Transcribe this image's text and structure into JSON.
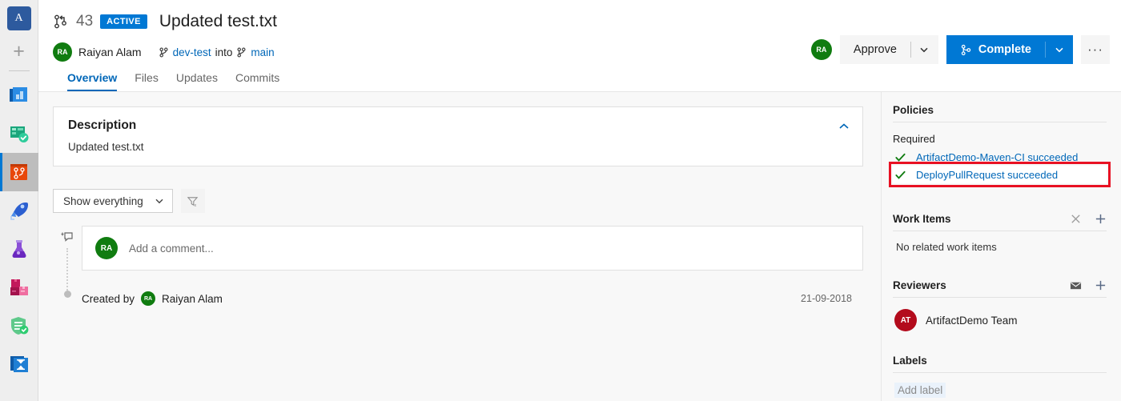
{
  "rail": {
    "org_initial": "A",
    "add_label": "+",
    "items": [
      {
        "name": "overview",
        "icon": "overview-icon"
      },
      {
        "name": "boards",
        "icon": "boards-icon"
      },
      {
        "name": "repos",
        "icon": "repos-icon",
        "selected": true
      },
      {
        "name": "pipelines",
        "icon": "pipelines-icon"
      },
      {
        "name": "test-plans",
        "icon": "test-plans-icon"
      },
      {
        "name": "artifacts",
        "icon": "artifacts-icon"
      },
      {
        "name": "security",
        "icon": "shield-icon"
      },
      {
        "name": "analytics",
        "icon": "hourglass-icon"
      }
    ]
  },
  "header": {
    "pr_number": "43",
    "status_badge": "ACTIVE",
    "title": "Updated test.txt",
    "author": "Raiyan Alam",
    "author_initials": "RA",
    "source_branch": "dev-test",
    "into_word": "into",
    "target_branch": "main",
    "tabs": [
      {
        "label": "Overview",
        "active": true
      },
      {
        "label": "Files",
        "active": false
      },
      {
        "label": "Updates",
        "active": false
      },
      {
        "label": "Commits",
        "active": false
      }
    ]
  },
  "actions": {
    "user_initials": "RA",
    "approve_label": "Approve",
    "complete_label": "Complete",
    "more_label": "···"
  },
  "description": {
    "title": "Description",
    "text": "Updated test.txt"
  },
  "filter": {
    "selected": "Show everything"
  },
  "discussion": {
    "comment_placeholder": "Add a comment...",
    "commenter_initials": "RA",
    "created_prefix": "Created by",
    "created_by": "Raiyan Alam",
    "created_initials": "RA",
    "created_date": "21-09-2018"
  },
  "sidebar": {
    "policies": {
      "title": "Policies",
      "required_label": "Required",
      "items": [
        {
          "text": "ArtifactDemo-Maven-CI succeeded",
          "status": "succeeded",
          "highlighted": false
        },
        {
          "text": "DeployPullRequest succeeded",
          "status": "succeeded",
          "highlighted": true
        }
      ]
    },
    "work_items": {
      "title": "Work Items",
      "empty_text": "No related work items"
    },
    "reviewers": {
      "title": "Reviewers",
      "list": [
        {
          "name": "ArtifactDemo Team",
          "initials": "AT"
        }
      ]
    },
    "labels": {
      "title": "Labels",
      "add_label": "Add label"
    }
  },
  "colors": {
    "accent": "#0078d4",
    "link": "#0067b8",
    "success": "#107c10",
    "highlight": "#e81123",
    "avatar_green": "#107c10",
    "avatar_red": "#b30b1c"
  }
}
